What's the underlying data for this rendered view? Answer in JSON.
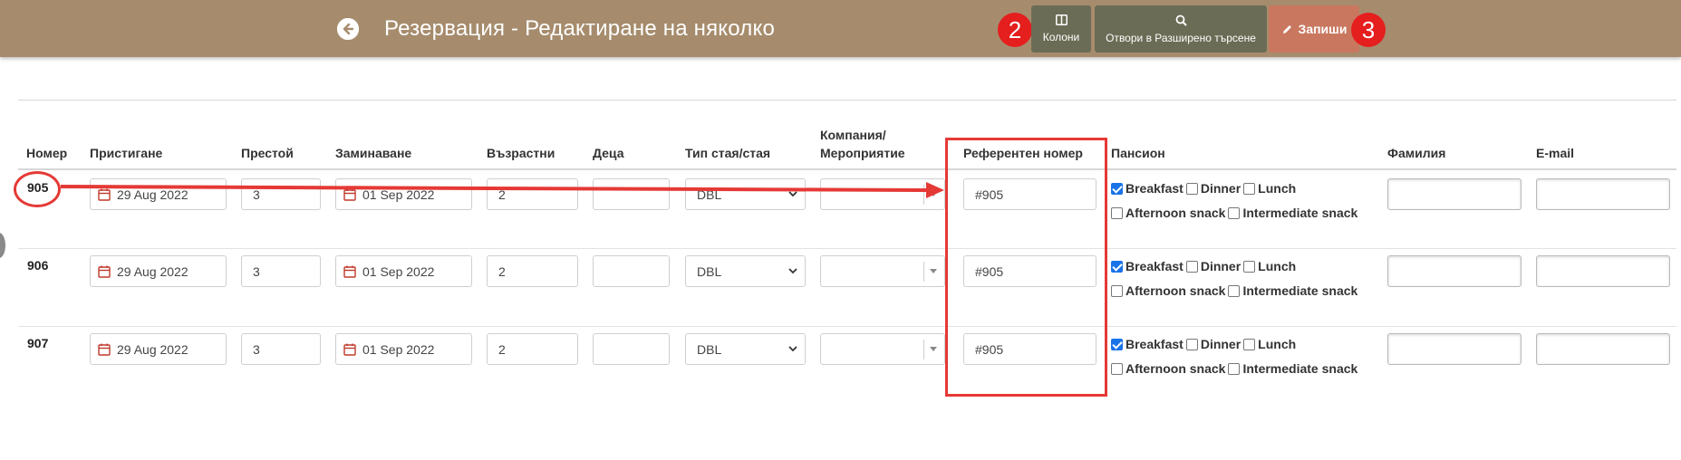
{
  "header": {
    "title": "Резервация - Редактиране на няколко",
    "columns_label": "Колони",
    "advanced_search_label": "Отвори в Разширено търсене",
    "save_label": "Запиши",
    "badges": [
      "2",
      "3"
    ],
    "colors": {
      "bar": "#a68c6d",
      "dark_button": "#6b6c55",
      "save_button": "#c9775f",
      "badge": "#e51e1e"
    }
  },
  "columns": {
    "number": "Номер",
    "arrival": "Пристигане",
    "stay": "Престой",
    "departure": "Заминаване",
    "adults": "Възрастни",
    "children": "Деца",
    "room_type": "Тип стая/стая",
    "company_line1": "Компания/",
    "company_line2": "Мероприятие",
    "reference": "Референтен номер",
    "board": "Пансион",
    "last_name": "Фамилия",
    "email": "E-mail"
  },
  "rows": [
    {
      "number": "905",
      "arrival": "29 Aug 2022",
      "stay": "3",
      "departure": "01 Sep 2022",
      "adults": "2",
      "children": "",
      "room_type": "DBL",
      "company": "",
      "reference": "#905",
      "last_name": "",
      "email": ""
    },
    {
      "number": "906",
      "arrival": "29 Aug 2022",
      "stay": "3",
      "departure": "01 Sep 2022",
      "adults": "2",
      "children": "",
      "room_type": "DBL",
      "company": "",
      "reference": "#905",
      "last_name": "",
      "email": ""
    },
    {
      "number": "907",
      "arrival": "29 Aug 2022",
      "stay": "3",
      "departure": "01 Sep 2022",
      "adults": "2",
      "children": "",
      "room_type": "DBL",
      "company": "",
      "reference": "#905",
      "last_name": "",
      "email": ""
    }
  ],
  "board_options": {
    "breakfast": "Breakfast",
    "dinner": "Dinner",
    "lunch": "Lunch",
    "afternoon_snack": "Afternoon snack",
    "intermediate_snack": "Intermediate snack",
    "checked": [
      "Breakfast"
    ]
  },
  "annotations": {
    "color": "#e53935"
  }
}
